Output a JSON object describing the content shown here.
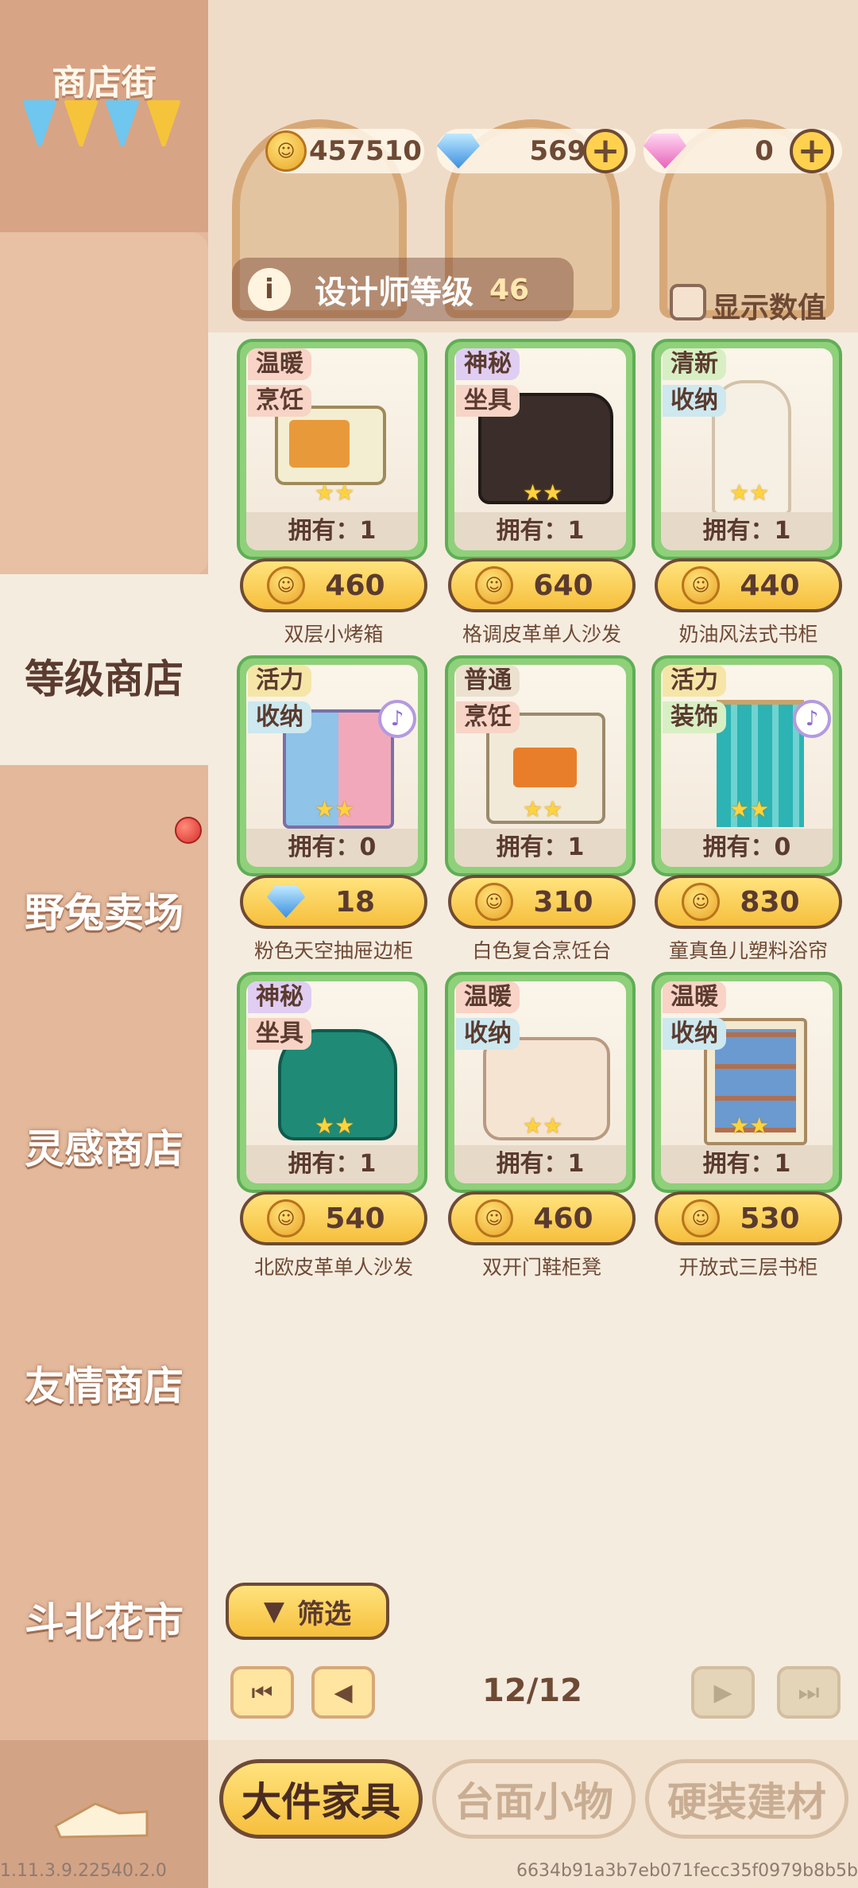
{
  "sidebar": {
    "title": "商店街",
    "items": [
      {
        "label": "等级商店",
        "active": true
      },
      {
        "label": "野兔卖场",
        "badge": true
      },
      {
        "label": "灵感商店"
      },
      {
        "label": "友情商店"
      },
      {
        "label": "斗北花市"
      }
    ]
  },
  "resources": {
    "coins": "457510",
    "diamonds": "569",
    "pink_gems": "0",
    "coin_icon": "cat-coin-icon",
    "diamond_icon": "blue-diamond-icon",
    "pink_icon": "pink-gem-icon"
  },
  "level": {
    "label": "设计师等级",
    "value": "46"
  },
  "show_values": {
    "label": "显示数值",
    "checked": false
  },
  "items": [
    {
      "tags": [
        "温暖",
        "烹饪"
      ],
      "owned": "拥有：1",
      "price": "460",
      "currency": "coin",
      "name": "双层小烤箱"
    },
    {
      "tags": [
        "神秘",
        "坐具"
      ],
      "owned": "拥有：1",
      "price": "640",
      "currency": "coin",
      "name": "格调皮革单人沙发"
    },
    {
      "tags": [
        "清新",
        "收纳"
      ],
      "owned": "拥有：1",
      "price": "440",
      "currency": "coin",
      "name": "奶油风法式书柜"
    },
    {
      "tags": [
        "活力",
        "收纳"
      ],
      "owned": "拥有：0",
      "price": "18",
      "currency": "diamond",
      "name": "粉色天空抽屉边柜",
      "note": true
    },
    {
      "tags": [
        "普通",
        "烹饪"
      ],
      "owned": "拥有：1",
      "price": "310",
      "currency": "coin",
      "name": "白色复合烹饪台"
    },
    {
      "tags": [
        "活力",
        "装饰"
      ],
      "owned": "拥有：0",
      "price": "830",
      "currency": "coin",
      "name": "童真鱼儿塑料浴帘",
      "note": true
    },
    {
      "tags": [
        "神秘",
        "坐具"
      ],
      "owned": "拥有：1",
      "price": "540",
      "currency": "coin",
      "name": "北欧皮革单人沙发"
    },
    {
      "tags": [
        "温暖",
        "收纳"
      ],
      "owned": "拥有：1",
      "price": "460",
      "currency": "coin",
      "name": "双开门鞋柜凳"
    },
    {
      "tags": [
        "温暖",
        "收纳"
      ],
      "owned": "拥有：1",
      "price": "530",
      "currency": "coin",
      "name": "开放式三层书柜"
    }
  ],
  "tag_colors": {
    "温暖": "#f8d3c6",
    "神秘": "#e0cdf2",
    "清新": "#d8efc4",
    "活力": "#f5e6a8",
    "普通": "#ece1cf",
    "烹饪": "#f7d4c6",
    "坐具": "#f7d4c6",
    "收纳": "#cde8ef",
    "装饰": "#d8efc4"
  },
  "filter": {
    "label": "筛选"
  },
  "pagination": {
    "current": "12/12"
  },
  "bottom_tabs": [
    {
      "label": "大件家具",
      "active": true
    },
    {
      "label": "台面小物"
    },
    {
      "label": "硬装建材"
    }
  ],
  "version": "1.11.3.9.22540.2.0",
  "build_hash": "6634b91a3b7eb071fecc35f0979b8b5b"
}
